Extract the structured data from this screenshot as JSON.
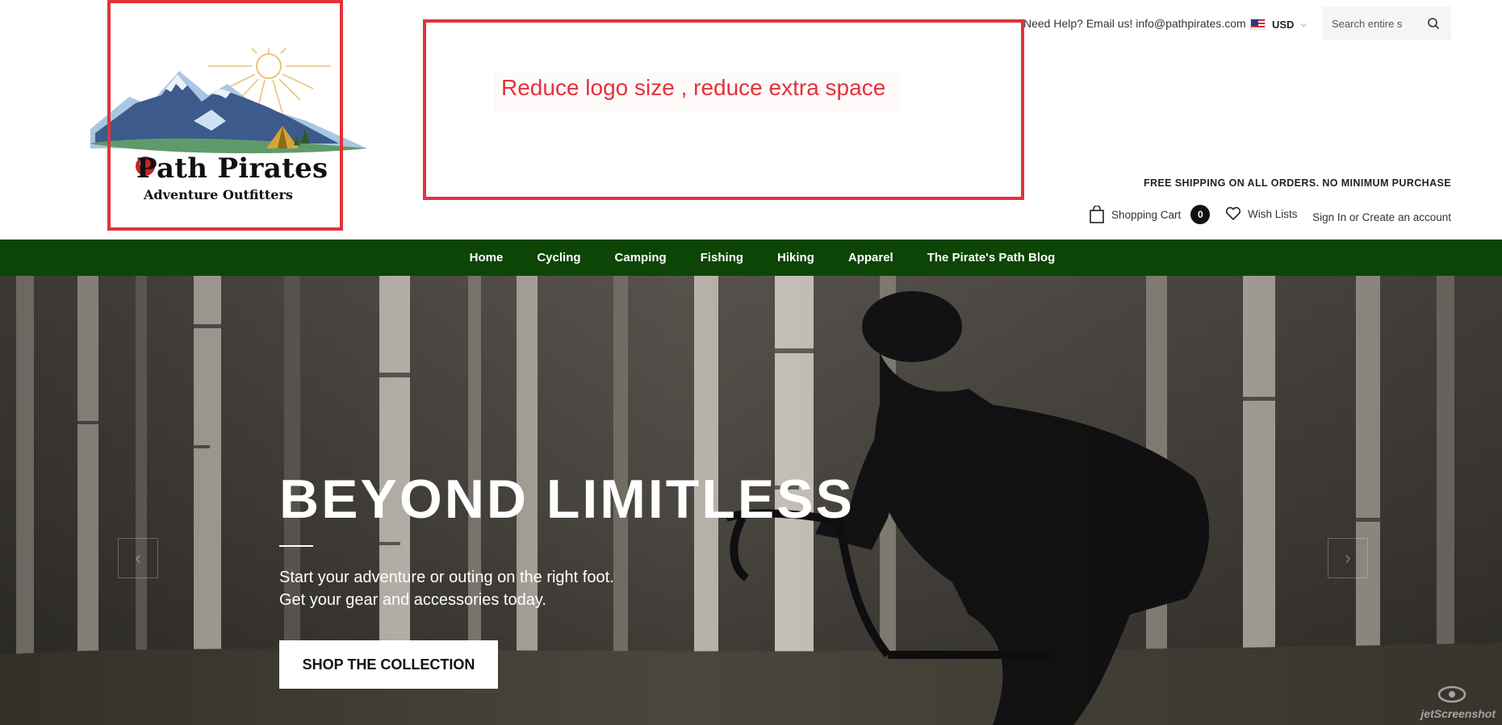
{
  "brand": {
    "name": "Path Pirates",
    "tagline": "Adventure Outfitters"
  },
  "annotation": {
    "note": "Reduce logo size , reduce extra space",
    "color": "#e3323a"
  },
  "topbar": {
    "help_text": "Need Help? Email us! info@pathpirates.com",
    "currency": "USD",
    "currency_flag_icon": "us-flag-icon",
    "search_placeholder": "Search entire s"
  },
  "shipping_banner": "FREE SHIPPING ON ALL ORDERS. NO MINIMUM PURCHASE",
  "cart": {
    "label": "Shopping Cart",
    "count": "0"
  },
  "wishlist": {
    "label": "Wish Lists"
  },
  "account": {
    "sign_in": "Sign In",
    "or": "or",
    "create": "Create an account"
  },
  "nav": {
    "background": "#0c4506",
    "items": [
      {
        "label": "Home"
      },
      {
        "label": "Cycling"
      },
      {
        "label": "Camping"
      },
      {
        "label": "Fishing"
      },
      {
        "label": "Hiking"
      },
      {
        "label": "Apparel"
      },
      {
        "label": "The Pirate's Path Blog"
      }
    ]
  },
  "hero": {
    "title": "BEYOND LIMITLESS",
    "subtitle_line1": "Start your adventure or outing on the right foot.",
    "subtitle_line2": "Get your gear and accessories today.",
    "cta": "SHOP THE COLLECTION",
    "prev_icon": "chevron-left-icon",
    "next_icon": "chevron-right-icon"
  },
  "watermark": "jetScreenshot"
}
